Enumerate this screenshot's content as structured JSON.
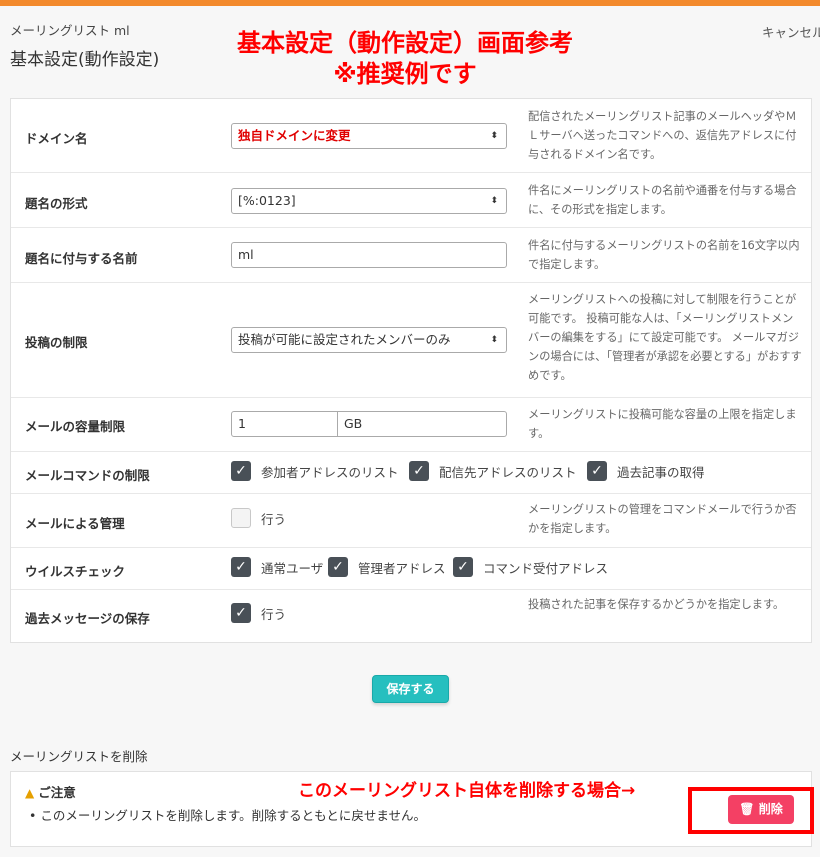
{
  "header": {
    "breadcrumb": "メーリングリスト ml",
    "title": "基本設定(動作設定)",
    "cancel_label": "キャンセル"
  },
  "annotations": {
    "title_line1": "基本設定（動作設定）画面参考",
    "title_line2": "※推奨例です",
    "delete_note": "このメーリングリスト自体を削除する場合→"
  },
  "form": {
    "domain": {
      "label": "ドメイン名",
      "value": "独自ドメインに変更",
      "help": "配信されたメーリングリスト記事のメールヘッダやＭＬサーバへ送ったコマンドへの、返信先アドレスに付与されるドメイン名です。"
    },
    "subject_format": {
      "label": "題名の形式",
      "value": "[%:0123]",
      "help": "件名にメーリングリストの名前や通番を付与する場合に、その形式を指定します。"
    },
    "subject_name": {
      "label": "題名に付与する名前",
      "value": "ml",
      "help": "件名に付与するメーリングリストの名前を16文字以内で指定します。"
    },
    "post_restriction": {
      "label": "投稿の制限",
      "value": "投稿が可能に設定されたメンバーのみ",
      "help": "メーリングリストへの投稿に対して制限を行うことが可能です。 投稿可能な人は、「メーリングリストメンバーの編集をする」にて設定可能です。 メールマガジンの場合には、「管理者が承認を必要とする」がおすすめです。"
    },
    "size_limit": {
      "label": "メールの容量制限",
      "value": "1",
      "unit": "GB",
      "help": "メーリングリストに投稿可能な容量の上限を指定します。"
    },
    "command_limit": {
      "label": "メールコマンドの制限",
      "options": [
        "参加者アドレスのリスト",
        "配信先アドレスのリスト",
        "過去記事の取得"
      ]
    },
    "mail_admin": {
      "label": "メールによる管理",
      "option": "行う",
      "help": "メーリングリストの管理をコマンドメールで行うか否かを指定します。"
    },
    "virus_check": {
      "label": "ウイルスチェック",
      "options": [
        "通常ユーザ",
        "管理者アドレス",
        "コマンド受付アドレス"
      ]
    },
    "archive": {
      "label": "過去メッセージの保存",
      "option": "行う",
      "help": "投稿された記事を保存するかどうかを指定します。"
    },
    "save_label": "保存する"
  },
  "delete_section": {
    "heading": "メーリングリストを削除",
    "notice_title": "ご注意",
    "notice_item": "このメーリングリストを削除します。削除するともとに戻せません。",
    "button_label": "削除"
  },
  "colors": {
    "top_bar": "#f38a2c",
    "save_button": "#26bfbf",
    "delete_button": "#f44064",
    "annotation": "#ff0000"
  }
}
